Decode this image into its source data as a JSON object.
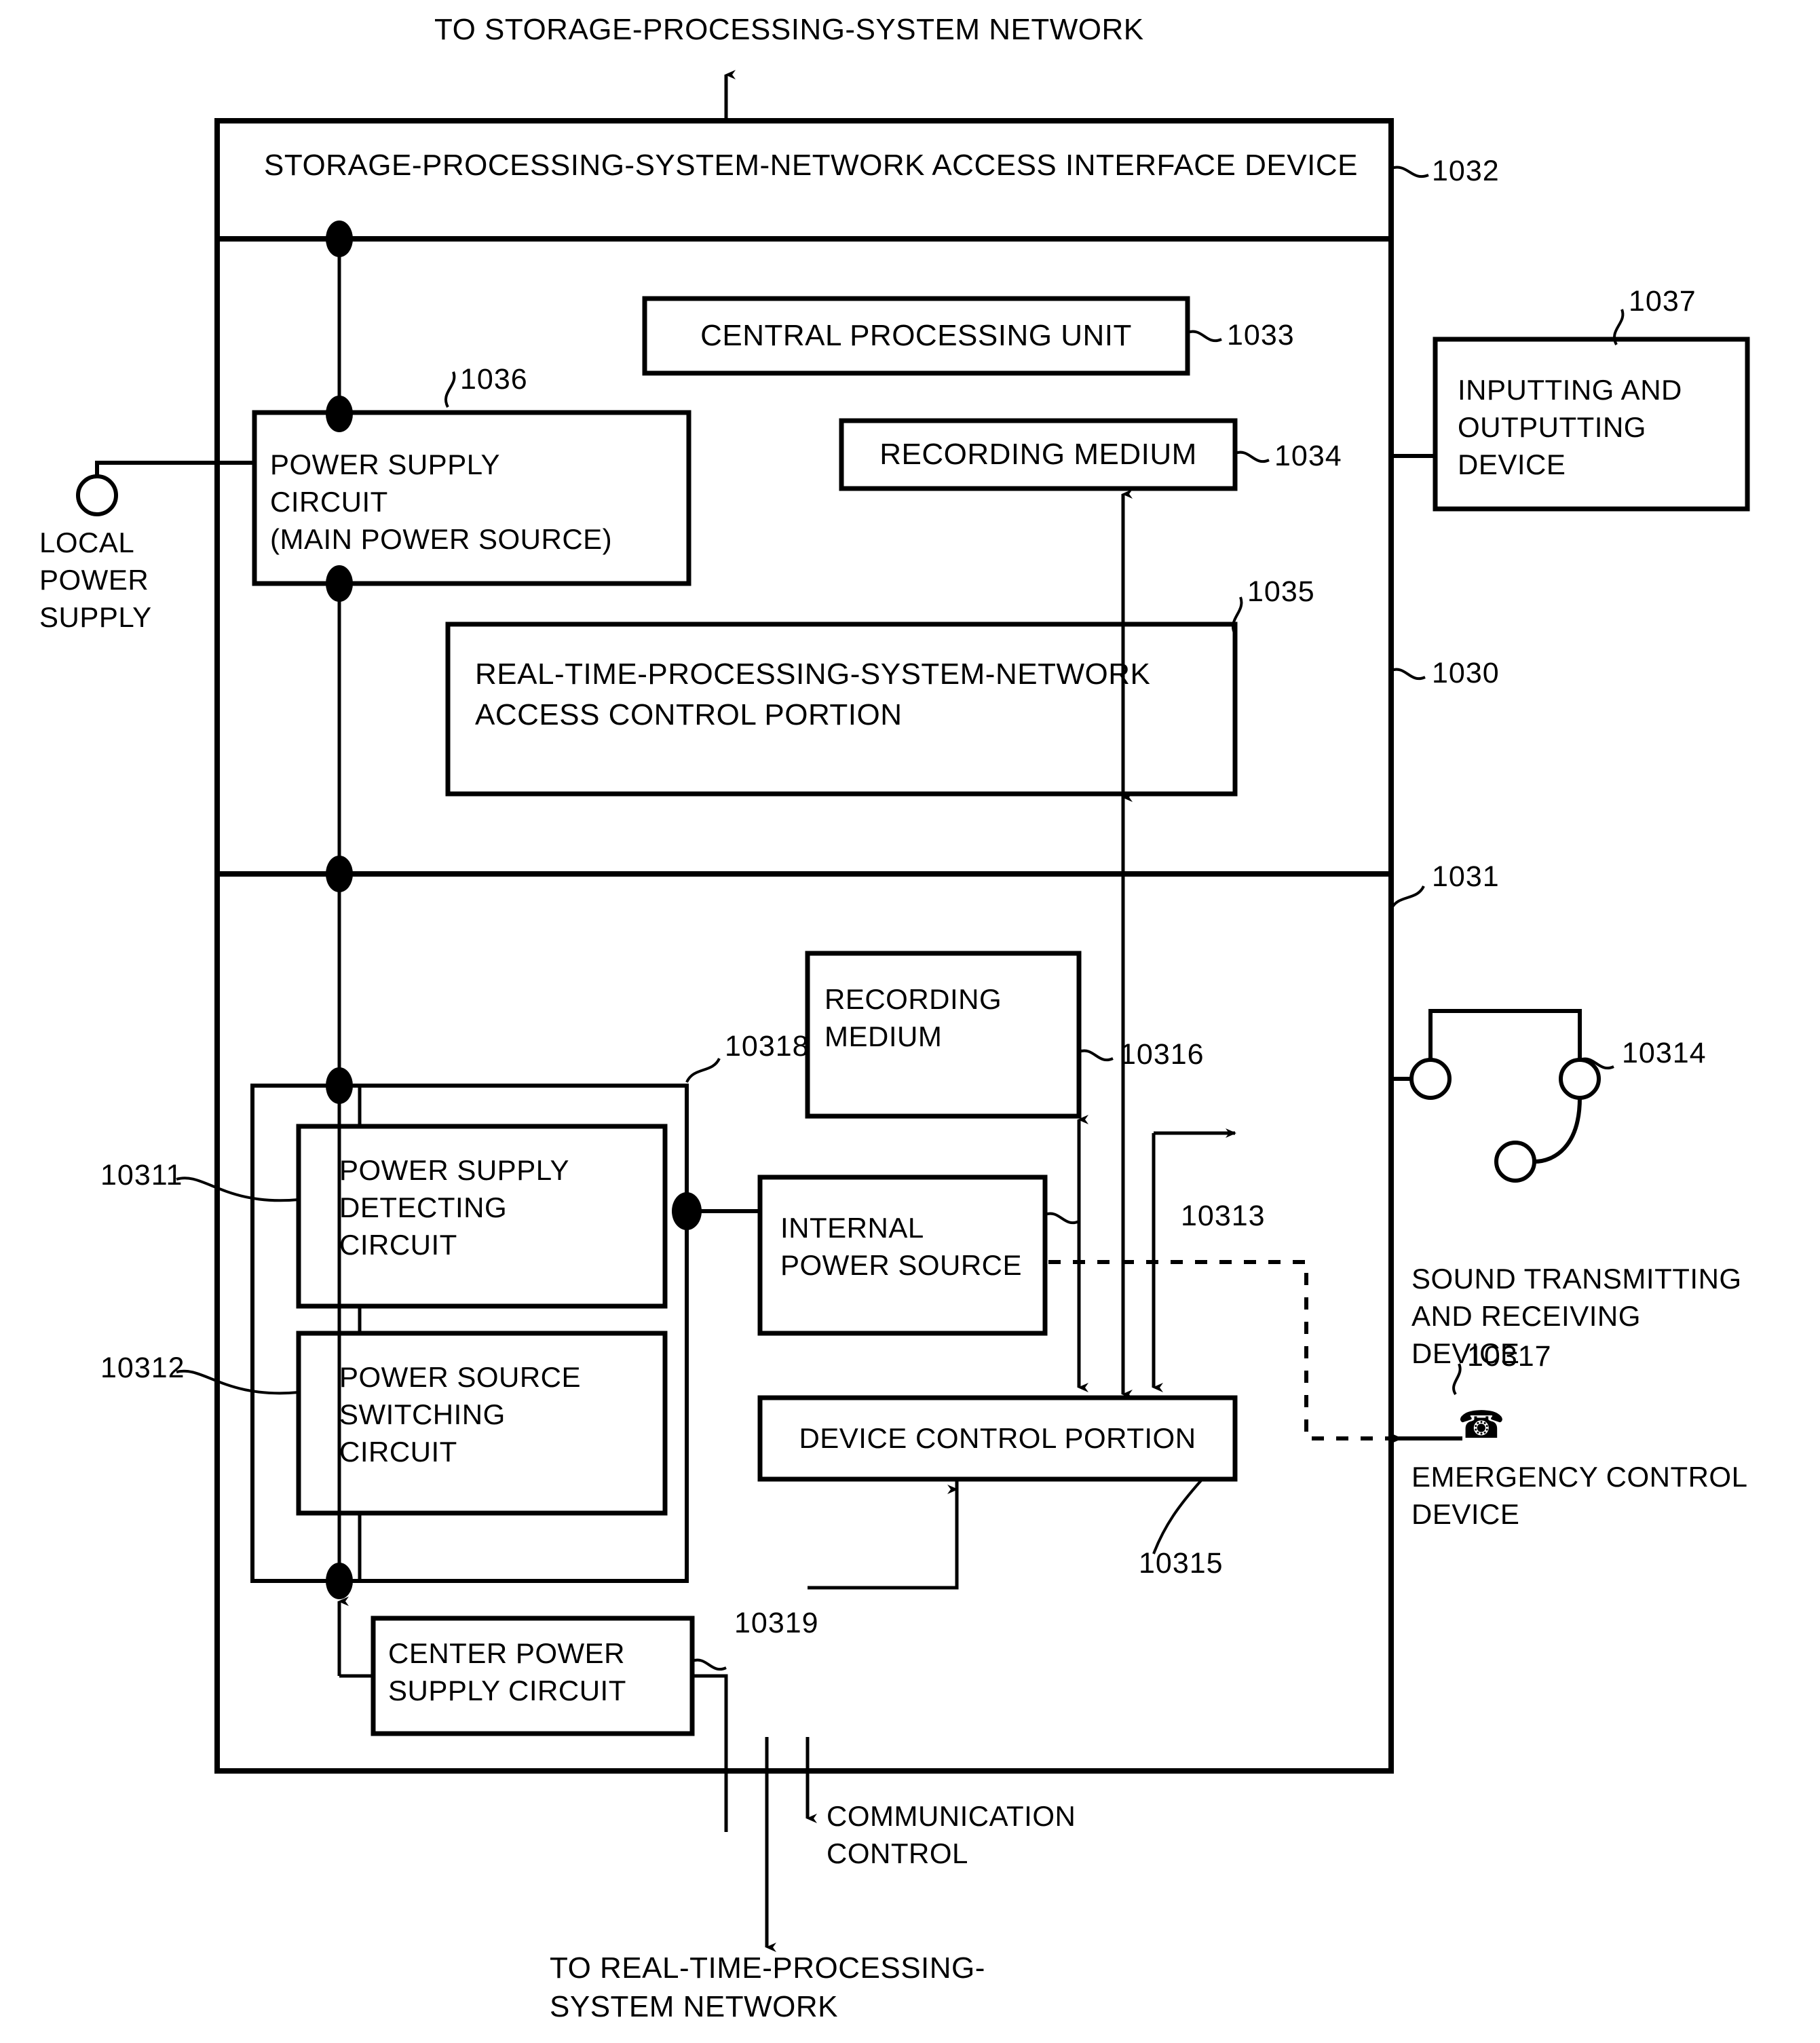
{
  "figure": {
    "top_annotation": "TO STORAGE-PROCESSING-SYSTEM NETWORK",
    "bottom_annotation_line1": "TO REAL-TIME-PROCESSING-",
    "bottom_annotation_line2": "SYSTEM NETWORK",
    "communication_control_line1": "COMMUNICATION",
    "communication_control_line2": "CONTROL"
  },
  "outer_device": {
    "interface_title": "STORAGE-PROCESSING-SYSTEM-NETWORK ACCESS INTERFACE DEVICE",
    "interface_ref": "1032",
    "upper_section_ref": "1030",
    "lower_section_ref": "1031"
  },
  "local_power": {
    "line1": "LOCAL",
    "line2": "POWER",
    "line3": "SUPPLY"
  },
  "upper_blocks": [
    {
      "name": "central-processing-unit",
      "lines": [
        "CENTRAL PROCESSING UNIT"
      ],
      "ref": "1033"
    },
    {
      "name": "recording-medium-upper",
      "lines": [
        "RECORDING MEDIUM"
      ],
      "ref": "1034"
    },
    {
      "name": "power-supply-circuit",
      "lines": [
        "POWER SUPPLY",
        "CIRCUIT",
        "(MAIN POWER SOURCE)"
      ],
      "ref": "1036"
    },
    {
      "name": "realtime-access-control-portion",
      "lines": [
        "REAL-TIME-PROCESSING-SYSTEM-NETWORK",
        "ACCESS CONTROL PORTION"
      ],
      "ref": "1035"
    }
  ],
  "external_devices": [
    {
      "name": "inputting-and-outputting-device",
      "lines": [
        "INPUTTING AND",
        "OUTPUTTING",
        "DEVICE"
      ],
      "ref": "1037"
    },
    {
      "name": "sound-transmitting-and-receiving-device",
      "lines": [
        "SOUND TRANSMITTING",
        "AND RECEIVING",
        "DEVICE"
      ],
      "ref": "10314"
    },
    {
      "name": "emergency-control-device",
      "lines": [
        "EMERGENCY CONTROL",
        "DEVICE"
      ],
      "ref": "10317",
      "icon": "telephone-icon",
      "glyph": "☎"
    }
  ],
  "lower_blocks": [
    {
      "name": "recording-medium-lower",
      "lines": [
        "RECORDING",
        "MEDIUM"
      ],
      "ref": "10316"
    },
    {
      "name": "power-supply-detecting-circuit",
      "lines": [
        "POWER SUPPLY",
        "DETECTING",
        "CIRCUIT"
      ],
      "ref": "10311"
    },
    {
      "name": "power-source-switching-circuit",
      "lines": [
        "POWER SOURCE",
        "SWITCHING",
        "CIRCUIT"
      ],
      "ref": "10312"
    },
    {
      "name": "internal-power-source",
      "lines": [
        "INTERNAL",
        "POWER SOURCE"
      ],
      "ref": "10313"
    },
    {
      "name": "device-control-portion",
      "lines": [
        "DEVICE CONTROL PORTION"
      ],
      "ref": "10315"
    },
    {
      "name": "center-power-supply-circuit",
      "lines": [
        "CENTER POWER",
        "SUPPLY CIRCUIT"
      ],
      "ref": "10319"
    },
    {
      "name": "power-group-enclosure",
      "lines": [],
      "ref": "10318"
    }
  ],
  "colors": {
    "line": "#000000",
    "background": "#ffffff"
  }
}
